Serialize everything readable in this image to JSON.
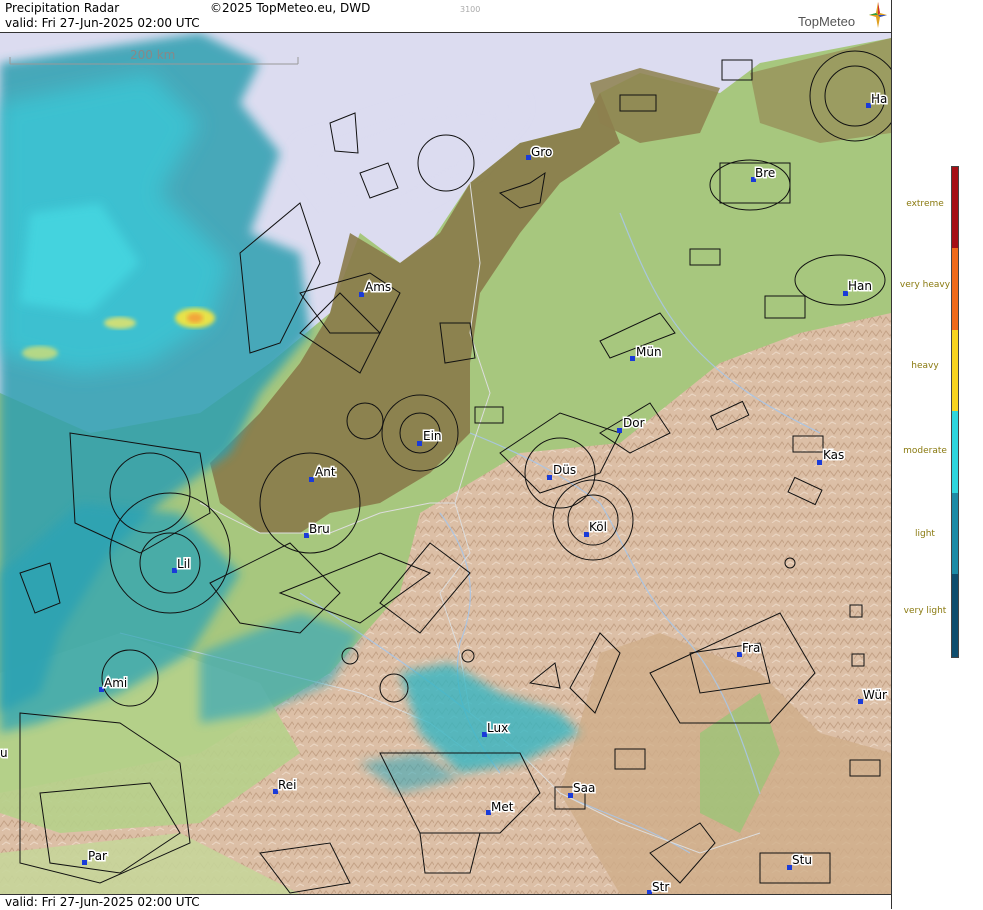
{
  "header": {
    "title": "Precipitation Radar",
    "copyright": "©2025 TopMeteo.eu, DWD",
    "code": "3100",
    "valid": "valid:  Fri  27-Jun-2025 02:00 UTC",
    "brand": "TopMeteo"
  },
  "footer": {
    "valid": "valid:  Fri  27-Jun-2025 02:00 UTC"
  },
  "map": {
    "scale_label": "200 km"
  },
  "cities": [
    {
      "label": "Gro"
    },
    {
      "label": "Bre"
    },
    {
      "label": "Ha"
    },
    {
      "label": "Ams"
    },
    {
      "label": "Han"
    },
    {
      "label": "Mün"
    },
    {
      "label": "Dor"
    },
    {
      "label": "Ein"
    },
    {
      "label": "Kas"
    },
    {
      "label": "Düs"
    },
    {
      "label": "Ant"
    },
    {
      "label": "Köl"
    },
    {
      "label": "Bru"
    },
    {
      "label": "Lil"
    },
    {
      "label": "Fra"
    },
    {
      "label": "Ami"
    },
    {
      "label": "Wür"
    },
    {
      "label": "Lux"
    },
    {
      "label": "Rei"
    },
    {
      "label": "Saa"
    },
    {
      "label": "Met"
    },
    {
      "label": "Par"
    },
    {
      "label": "Stu"
    },
    {
      "label": "Str"
    },
    {
      "label": "u"
    }
  ],
  "legend": [
    {
      "label": "extreme",
      "color": "#a50f15"
    },
    {
      "label": "very heavy",
      "color": "#ef6a1a"
    },
    {
      "label": "heavy",
      "color": "#f7d31e"
    },
    {
      "label": "moderate",
      "color": "#2ed6de"
    },
    {
      "label": "light",
      "color": "#1d8ba6"
    },
    {
      "label": "very light",
      "color": "#0f4e6e"
    }
  ],
  "colors": {
    "sea": "#dcdcf0",
    "lowland_dark": "#8a7a4a",
    "green": "#9cc477",
    "hills": "#d9b79a",
    "radar_light": "#3aa6b5",
    "radar_moderate": "#43d0e0",
    "radar_heavy": "#e8e64c"
  }
}
